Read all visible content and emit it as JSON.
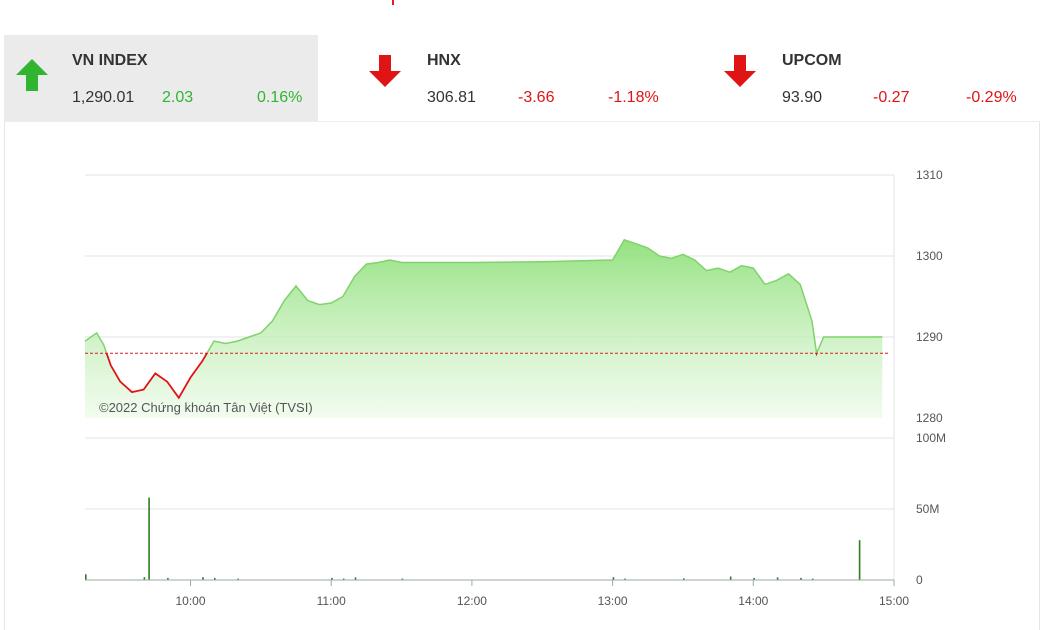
{
  "indices": [
    {
      "name": "VN INDEX",
      "value": "1,290.01",
      "change": "2.03",
      "pct": "0.16%",
      "direction": "up",
      "active": true,
      "icon": "arrow-up-icon"
    },
    {
      "name": "HNX",
      "value": "306.81",
      "change": "-3.66",
      "pct": "-1.18%",
      "direction": "down",
      "active": false,
      "icon": "arrow-down-icon"
    },
    {
      "name": "UPCOM",
      "value": "93.90",
      "change": "-0.27",
      "pct": "-0.29%",
      "direction": "down",
      "active": false,
      "icon": "arrow-down-icon"
    }
  ],
  "colors": {
    "up": "#31b531",
    "down": "#e01414",
    "reference": "#d42020",
    "volume": "#2e7d1e",
    "area_top": "#8fe07a"
  },
  "chart_data": [
    {
      "type": "area",
      "title": "",
      "watermark": "©2022 Chứng khoán Tân Việt (TVSI)",
      "xlabel": "",
      "ylabel": "",
      "x_ticks": [
        "10:00",
        "11:00",
        "12:00",
        "13:00",
        "14:00",
        "15:00"
      ],
      "y_ticks": [
        "1310",
        "1300",
        "1290",
        "1280"
      ],
      "ylim": [
        1280,
        1310
      ],
      "xlim": [
        "09:15",
        "15:00"
      ],
      "reference_value": 1288,
      "grid": true,
      "series": [
        {
          "values": [
            [
              "09:15",
              1289.5
            ],
            [
              "09:20",
              1290.5
            ],
            [
              "09:23",
              1289.0
            ],
            [
              "09:26",
              1286.5
            ],
            [
              "09:30",
              1284.5
            ],
            [
              "09:35",
              1283.2
            ],
            [
              "09:40",
              1283.5
            ],
            [
              "09:45",
              1285.5
            ],
            [
              "09:50",
              1284.5
            ],
            [
              "09:55",
              1282.5
            ],
            [
              "10:00",
              1285.0
            ],
            [
              "10:05",
              1287.0
            ],
            [
              "10:10",
              1289.5
            ],
            [
              "10:15",
              1289.2
            ],
            [
              "10:20",
              1289.5
            ],
            [
              "10:25",
              1290.0
            ],
            [
              "10:30",
              1290.5
            ],
            [
              "10:35",
              1292.0
            ],
            [
              "10:40",
              1294.5
            ],
            [
              "10:45",
              1296.3
            ],
            [
              "10:50",
              1294.5
            ],
            [
              "10:55",
              1294.0
            ],
            [
              "11:00",
              1294.2
            ],
            [
              "11:05",
              1295.0
            ],
            [
              "11:10",
              1297.5
            ],
            [
              "11:15",
              1299.0
            ],
            [
              "11:20",
              1299.2
            ],
            [
              "11:25",
              1299.5
            ],
            [
              "11:30",
              1299.2
            ],
            [
              "12:00",
              1299.2
            ],
            [
              "12:30",
              1299.3
            ],
            [
              "13:00",
              1299.5
            ],
            [
              "13:05",
              1302.0
            ],
            [
              "13:10",
              1301.5
            ],
            [
              "13:15",
              1301.0
            ],
            [
              "13:20",
              1300.0
            ],
            [
              "13:25",
              1299.7
            ],
            [
              "13:30",
              1300.2
            ],
            [
              "13:35",
              1299.5
            ],
            [
              "13:40",
              1298.2
            ],
            [
              "13:45",
              1298.5
            ],
            [
              "13:50",
              1298.0
            ],
            [
              "13:55",
              1298.8
            ],
            [
              "14:00",
              1298.5
            ],
            [
              "14:05",
              1296.5
            ],
            [
              "14:10",
              1297.0
            ],
            [
              "14:15",
              1297.8
            ],
            [
              "14:20",
              1296.5
            ],
            [
              "14:25",
              1292.0
            ],
            [
              "14:27",
              1288.0
            ],
            [
              "14:30",
              1290.0
            ],
            [
              "14:45",
              1290.0
            ],
            [
              "14:50",
              1290.0
            ],
            [
              "14:55",
              1290.01
            ]
          ]
        }
      ]
    },
    {
      "type": "bar",
      "title": "",
      "y_ticks": [
        "100M",
        "50M",
        "0"
      ],
      "ylim": [
        0,
        100
      ],
      "unit": "M",
      "series": [
        {
          "values": [
            [
              "09:15",
              4
            ],
            [
              "09:40",
              2
            ],
            [
              "09:42",
              58
            ],
            [
              "09:50",
              1.5
            ],
            [
              "10:05",
              2
            ],
            [
              "10:10",
              1.5
            ],
            [
              "10:20",
              1
            ],
            [
              "11:00",
              1.5
            ],
            [
              "11:05",
              1
            ],
            [
              "11:10",
              1.8
            ],
            [
              "11:30",
              1
            ],
            [
              "13:00",
              2
            ],
            [
              "13:05",
              1
            ],
            [
              "13:30",
              1.2
            ],
            [
              "13:50",
              2.5
            ],
            [
              "14:00",
              1.5
            ],
            [
              "14:10",
              1.8
            ],
            [
              "14:20",
              1.5
            ],
            [
              "14:25",
              1
            ],
            [
              "14:45",
              28
            ]
          ]
        }
      ]
    }
  ]
}
